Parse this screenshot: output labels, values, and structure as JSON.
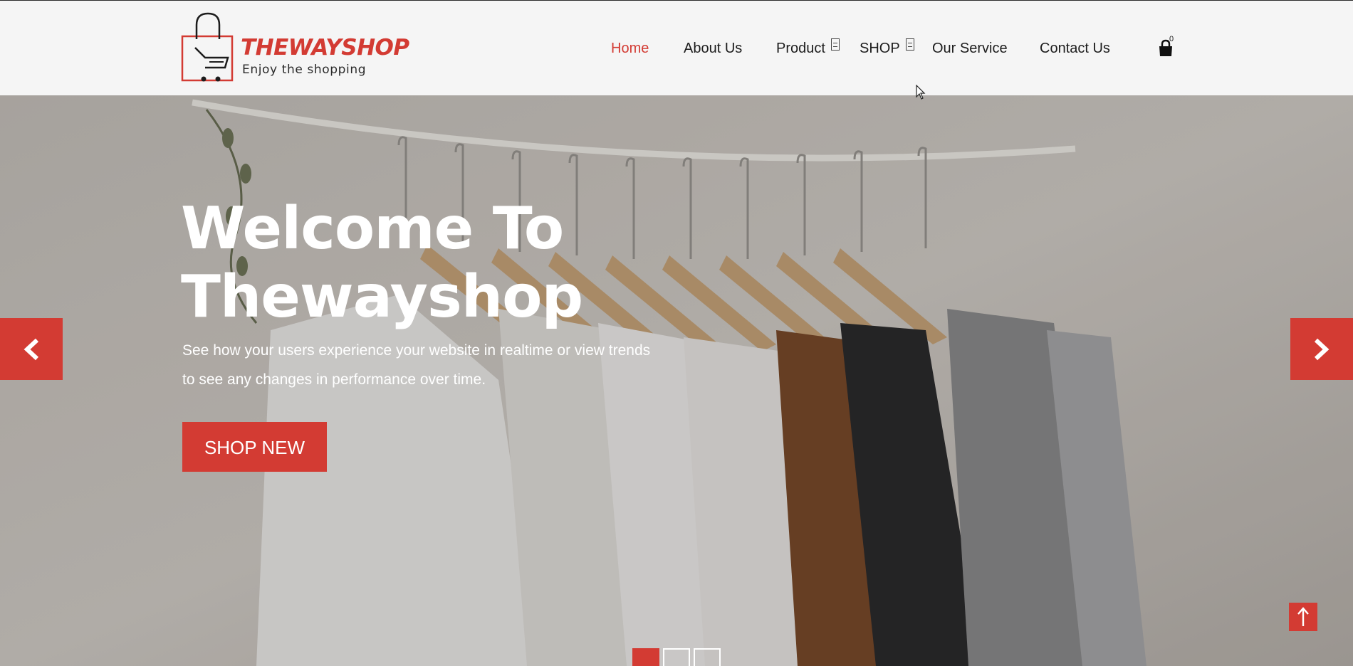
{
  "brand": {
    "name": "THEWAYSHOP",
    "tagline": "Enjoy the shopping",
    "accent_color": "#d33b33"
  },
  "nav": {
    "items": [
      {
        "label": "Home",
        "active": true
      },
      {
        "label": "About Us"
      },
      {
        "label": "Product",
        "dropdown": true
      },
      {
        "label": "SHOP",
        "dropdown": true
      },
      {
        "label": "Our Service"
      },
      {
        "label": "Contact Us"
      }
    ],
    "cart": {
      "icon": "shopping-bag-icon",
      "count": "0"
    }
  },
  "hero": {
    "title": "Welcome To Thewayshop",
    "subtitle": "See how your users experience your website in realtime or view trends to see any changes in performance over time.",
    "cta_label": "SHOP NEW",
    "prev_icon": "chevron-left-icon",
    "next_icon": "chevron-right-icon",
    "slides_total": 3,
    "active_slide": 1
  },
  "back_to_top": {
    "icon": "arrow-up-icon"
  }
}
